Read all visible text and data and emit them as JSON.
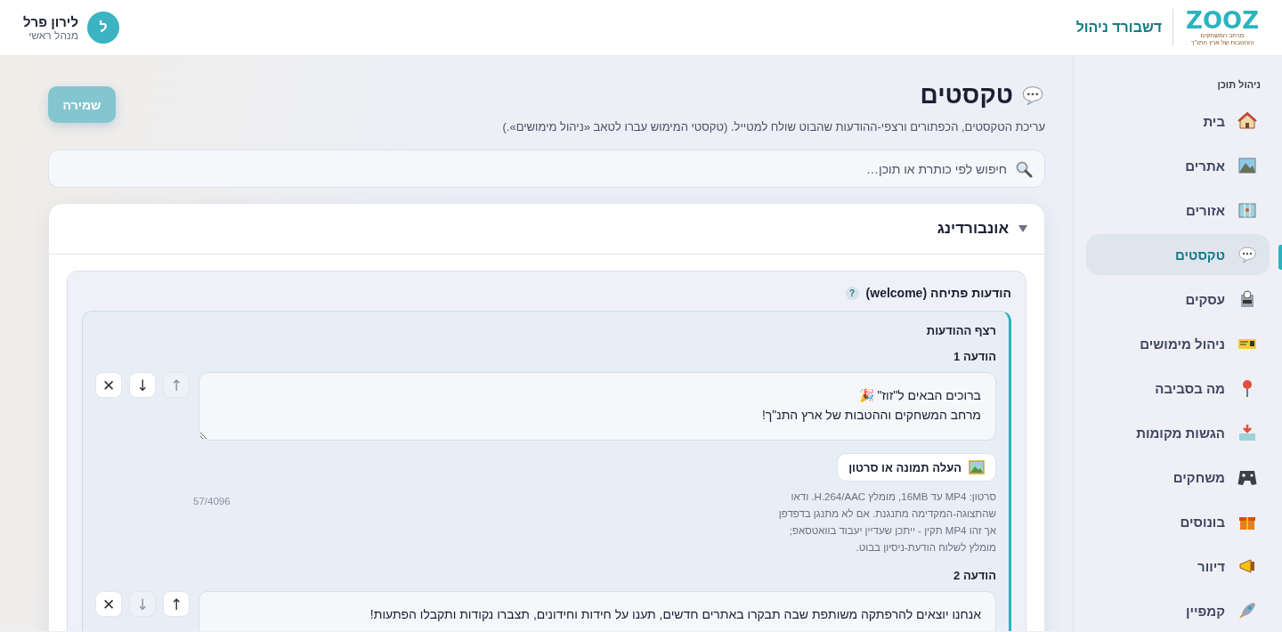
{
  "header": {
    "logo_text": "ZOOZ",
    "tagline": "מרחב המשחקים וההטבות של ארץ התנ\"ך",
    "title": "דשבורד ניהול",
    "user": {
      "initial": "ל",
      "name": "לירון פרל",
      "role": "מנהל ראשי"
    }
  },
  "sidebar": {
    "heading": "ניהול תוכן",
    "items": [
      {
        "label": "בית",
        "selected": false
      },
      {
        "label": "אתרים",
        "selected": false
      },
      {
        "label": "אזורים",
        "selected": false
      },
      {
        "label": "טקסטים",
        "selected": true
      },
      {
        "label": "עסקים",
        "selected": false
      },
      {
        "label": "ניהול מימושים",
        "selected": false
      },
      {
        "label": "מה בסביבה",
        "selected": false
      },
      {
        "label": "הגשות מקומות",
        "selected": false
      },
      {
        "label": "משחקים",
        "selected": false
      },
      {
        "label": "בונוסים",
        "selected": false
      },
      {
        "label": "דיוור",
        "selected": false
      },
      {
        "label": "קמפיין",
        "selected": false
      }
    ]
  },
  "page": {
    "title": "טקסטים",
    "subtitle": "עריכת הטקסטים, הכפתורים ורצפי-ההודעות שהבוט שולח למטייל. (טקסטי המימוש עברו לטאב «ניהול מימושים».)",
    "save_button": {
      "label": "שמירה",
      "disabled": true
    },
    "search": {
      "placeholder": "חיפוש לפי כותרת או תוכן…"
    }
  },
  "sections": [
    {
      "title": "אונבורדינג",
      "expanded": true,
      "groups": [
        {
          "title": "הודעות פתיחה (welcome)",
          "help": "?",
          "sequence_title": "רצף ההודעות",
          "messages": [
            {
              "label": "הודעה 1",
              "text": "ברוכים הבאים ל\"זוז\" 🎉\nמרחב המשחקים וההטבות של ארץ התנ\"ך!",
              "controls": [
                {
                  "kind": "up",
                  "symbol": "↑",
                  "disabled": true
                },
                {
                  "kind": "down",
                  "symbol": "↓",
                  "disabled": false
                },
                {
                  "kind": "delete",
                  "symbol": "✕",
                  "disabled": false
                }
              ],
              "upload_button": "העלה תמונה או סרטון",
              "hint": "סרטון: MP4 עד 16MB, מומלץ H.264/AAC. ודאו שהתצוגה-המקדימה מתנגנת. אם לא מתנגן בדפדפן אך זהו MP4 תקין - ייתכן שעדיין יעבוד בוואטסאפ; מומלץ לשלוח הודעת-ניסיון בבוט.",
              "counter": "57/4096"
            },
            {
              "label": "הודעה 2",
              "text": "אנחנו יוצאים להרפתקה משותפת שבה תבקרו באתרים חדשים, תענו על חידות וחידונים, תצברו נקודות ותקבלו הפתעות!",
              "controls": [
                {
                  "kind": "up",
                  "symbol": "↑",
                  "disabled": false
                },
                {
                  "kind": "down",
                  "symbol": "↓",
                  "disabled": true
                },
                {
                  "kind": "delete",
                  "symbol": "✕",
                  "disabled": false
                }
              ]
            }
          ]
        }
      ]
    }
  ]
}
